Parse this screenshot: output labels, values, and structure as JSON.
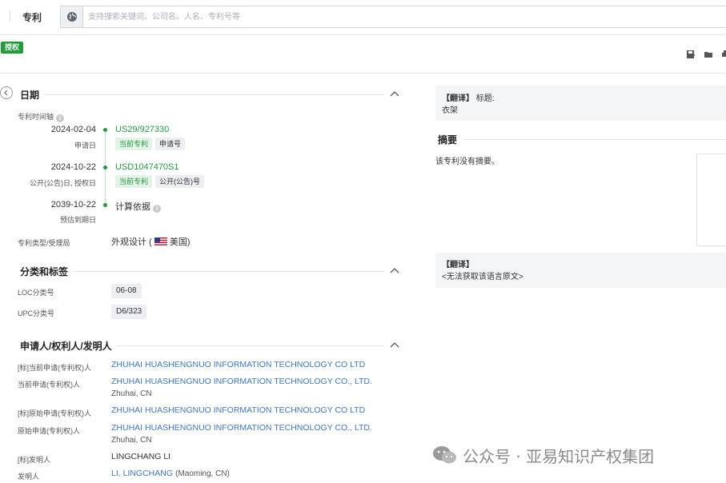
{
  "topbar": {
    "scope_label": "专利",
    "search_placeholder": "支持搜索关键词、公司名、人名、专利号等"
  },
  "status": {
    "badge": "授权",
    "toolbar_icons": [
      "save-icon",
      "folder-icon",
      "print-icon"
    ]
  },
  "dates": {
    "title": "日期",
    "timeline_label": "专利时间轴",
    "events": [
      {
        "date": "2024-02-04",
        "sub": "申请日",
        "number": "US29/927330",
        "tags": [
          "当前专利",
          "申请号"
        ]
      },
      {
        "date": "2024-10-22",
        "sub": "公开(公告)日, 授权日",
        "number": "USD1047470S1",
        "tags": [
          "当前专利",
          "公开(公告)号"
        ]
      },
      {
        "date": "2039-10-22",
        "sub": "预估到期日",
        "number": "计算依据",
        "tags": []
      }
    ],
    "type_label": "专利类型/受理局",
    "type_value": "外观设计 (",
    "country": "美国",
    "type_close": ")"
  },
  "classification": {
    "title": "分类和标签",
    "loc_label": "LOC分类号",
    "loc_value": "06-08",
    "upc_label": "UPC分类号",
    "upc_value": "D6/323"
  },
  "parties": {
    "title": "申请人/权利人/发明人",
    "rows": [
      {
        "label": "[标]当前申请(专利权)人",
        "value": "ZHUHAI HUASHENGNUO INFORMATION TECHNOLOGY CO LTD",
        "sub": ""
      },
      {
        "label": "当前申请(专利权)人",
        "value": "ZHUHAI HUASHENGNUO INFORMATION TECHNOLOGY CO., LTD.",
        "sub": "Zhuhai, CN"
      },
      {
        "label": "[标]原始申请(专利权)人",
        "value": "ZHUHAI HUASHENGNUO INFORMATION TECHNOLOGY CO LTD",
        "sub": ""
      },
      {
        "label": "原始申请(专利权)人",
        "value": "ZHUHAI HUASHENGNUO INFORMATION TECHNOLOGY CO., LTD.",
        "sub": "Zhuhai, CN"
      },
      {
        "label": "[标]发明人",
        "value": "LINGCHANG LI",
        "sub": ""
      },
      {
        "label": "发明人",
        "value": "LI, LINGCHANG",
        "sub": "(Maoming, CN)"
      }
    ]
  },
  "right": {
    "translate_tag": "【翻译】",
    "title_label": "标题:",
    "title_value": "衣架",
    "abstract_title": "摘要",
    "abstract_text": "该专利没有摘要。",
    "translate_tag2": "【翻译】",
    "no_source": "<无法获取该语言原文>"
  },
  "watermark": "公众号 · 亚易知识产权集团"
}
